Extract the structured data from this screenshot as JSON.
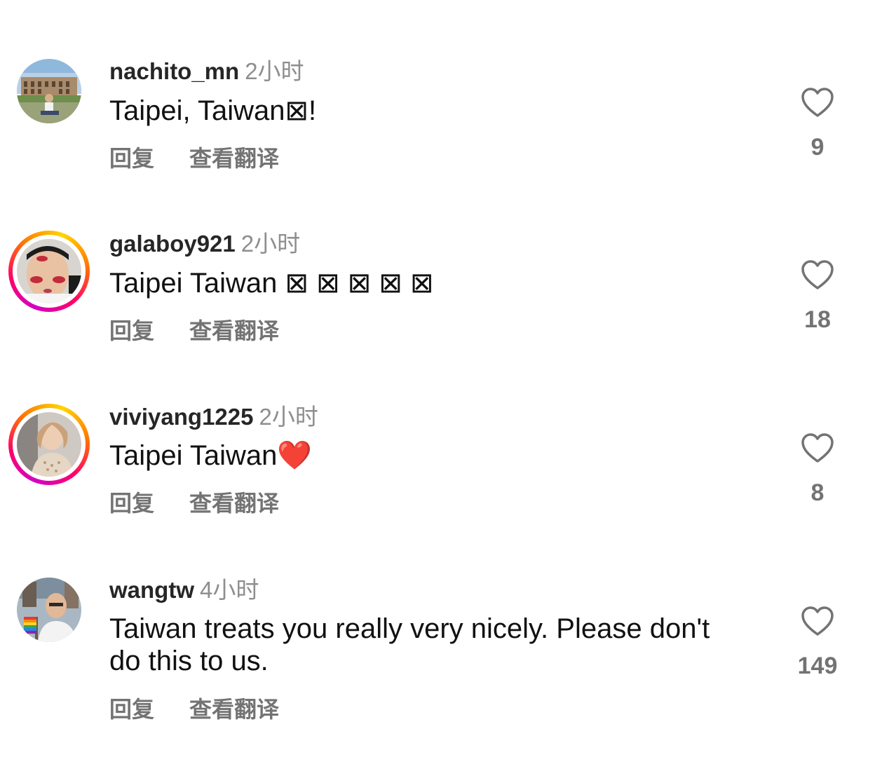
{
  "comments": [
    {
      "username": "nachito_mn",
      "time": "2小时",
      "text": "Taipei, Taiwan⊠!",
      "reply_label": "回复",
      "translate_label": "查看翻译",
      "likes": "9",
      "story_ring": false,
      "avatar_icon": "avatar-colosseum"
    },
    {
      "username": "galaboy921",
      "time": "2小时",
      "text": "Taipei Taiwan ⊠ ⊠ ⊠ ⊠ ⊠",
      "reply_label": "回复",
      "translate_label": "查看翻译",
      "likes": "18",
      "story_ring": true,
      "avatar_icon": "avatar-face-lipstick"
    },
    {
      "username": "viviyang1225",
      "time": "2小时",
      "text": "Taipei Taiwan❤️",
      "reply_label": "回复",
      "translate_label": "查看翻译",
      "likes": "8",
      "story_ring": true,
      "avatar_icon": "avatar-woman"
    },
    {
      "username": "wangtw",
      "time": "4小时",
      "text": "Taiwan treats you really very nicely. Please don't\ndo this to us.",
      "reply_label": "回复",
      "translate_label": "查看翻译",
      "likes": "149",
      "story_ring": false,
      "avatar_icon": "avatar-man-rainbow-flag"
    }
  ],
  "colors": {
    "text": "#111111",
    "username": "#262626",
    "muted": "#8e8e8e",
    "action": "#737373",
    "heart_red": "#e8232c"
  }
}
